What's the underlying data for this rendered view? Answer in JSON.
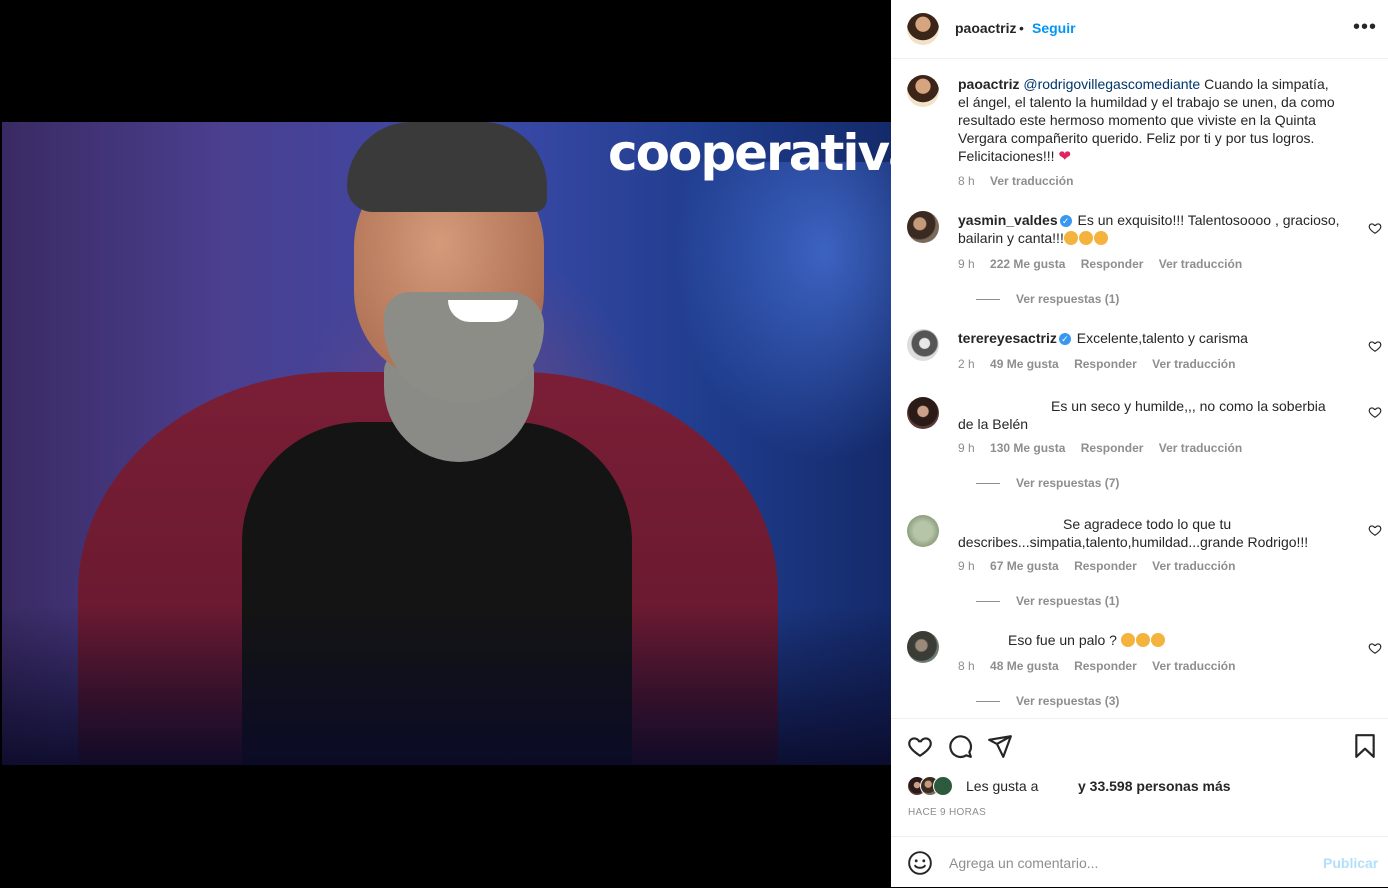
{
  "post": {
    "brand_overlay": "cooperativa",
    "author": "paoactriz",
    "follow_label": "Seguir",
    "more_label": "•••",
    "dot": "•"
  },
  "caption": {
    "user": "paoactriz",
    "mention": "@rodrigovillegascomediante",
    "text": " Cuando la simpatía, el ángel, el talento la humildad y el trabajo se unen, da como resultado este hermoso momento que viviste en la Quinta Vergara compañerito querido. Feliz por ti y por tus logros. Felicitaciones!!! ",
    "heart": "❤",
    "time": "8 h",
    "translate": "Ver traducción"
  },
  "comments": [
    {
      "user": "yasmin_valdes",
      "verified": true,
      "text": " Es un exquisito!!! Talentosoooo , gracioso, bailarin y canta!!!",
      "emojis": 3,
      "time": "9 h",
      "likes": "222 Me gusta",
      "reply": "Responder",
      "translate": "Ver traducción",
      "replies": "Ver respuestas (1)"
    },
    {
      "user": "terereyesactriz",
      "verified": true,
      "text": " Excelente,talento y carisma",
      "time": "2 h",
      "likes": "49 Me gusta",
      "reply": "Responder",
      "translate": "Ver traducción"
    },
    {
      "user": "",
      "text": "Es un seco y humilde,,, no como la soberbia de la Belén",
      "time": "9 h",
      "likes": "130 Me gusta",
      "reply": "Responder",
      "translate": "Ver traducción",
      "replies": "Ver respuestas (7)"
    },
    {
      "user": "",
      "text": "Se agradece todo lo que tu describes...simpatia,talento,humildad...grande Rodrigo!!!",
      "time": "9 h",
      "likes": "67 Me gusta",
      "reply": "Responder",
      "translate": "Ver traducción",
      "replies": "Ver respuestas (1)"
    },
    {
      "user": "",
      "text": "Eso fue un palo ? ",
      "emojis": 3,
      "time": "8 h",
      "likes": "48 Me gusta",
      "reply": "Responder",
      "translate": "Ver traducción",
      "replies": "Ver respuestas (3)"
    }
  ],
  "likes": {
    "prefix": "Les gusta a",
    "suffix": "y 33.598 personas más"
  },
  "timestamp": "HACE 9 HORAS",
  "composer": {
    "placeholder": "Agrega un comentario...",
    "publish": "Publicar"
  },
  "icons": [
    "heart-icon",
    "comment-icon",
    "share-icon",
    "bookmark-icon",
    "emoji-icon",
    "more-icon",
    "verified-icon"
  ]
}
